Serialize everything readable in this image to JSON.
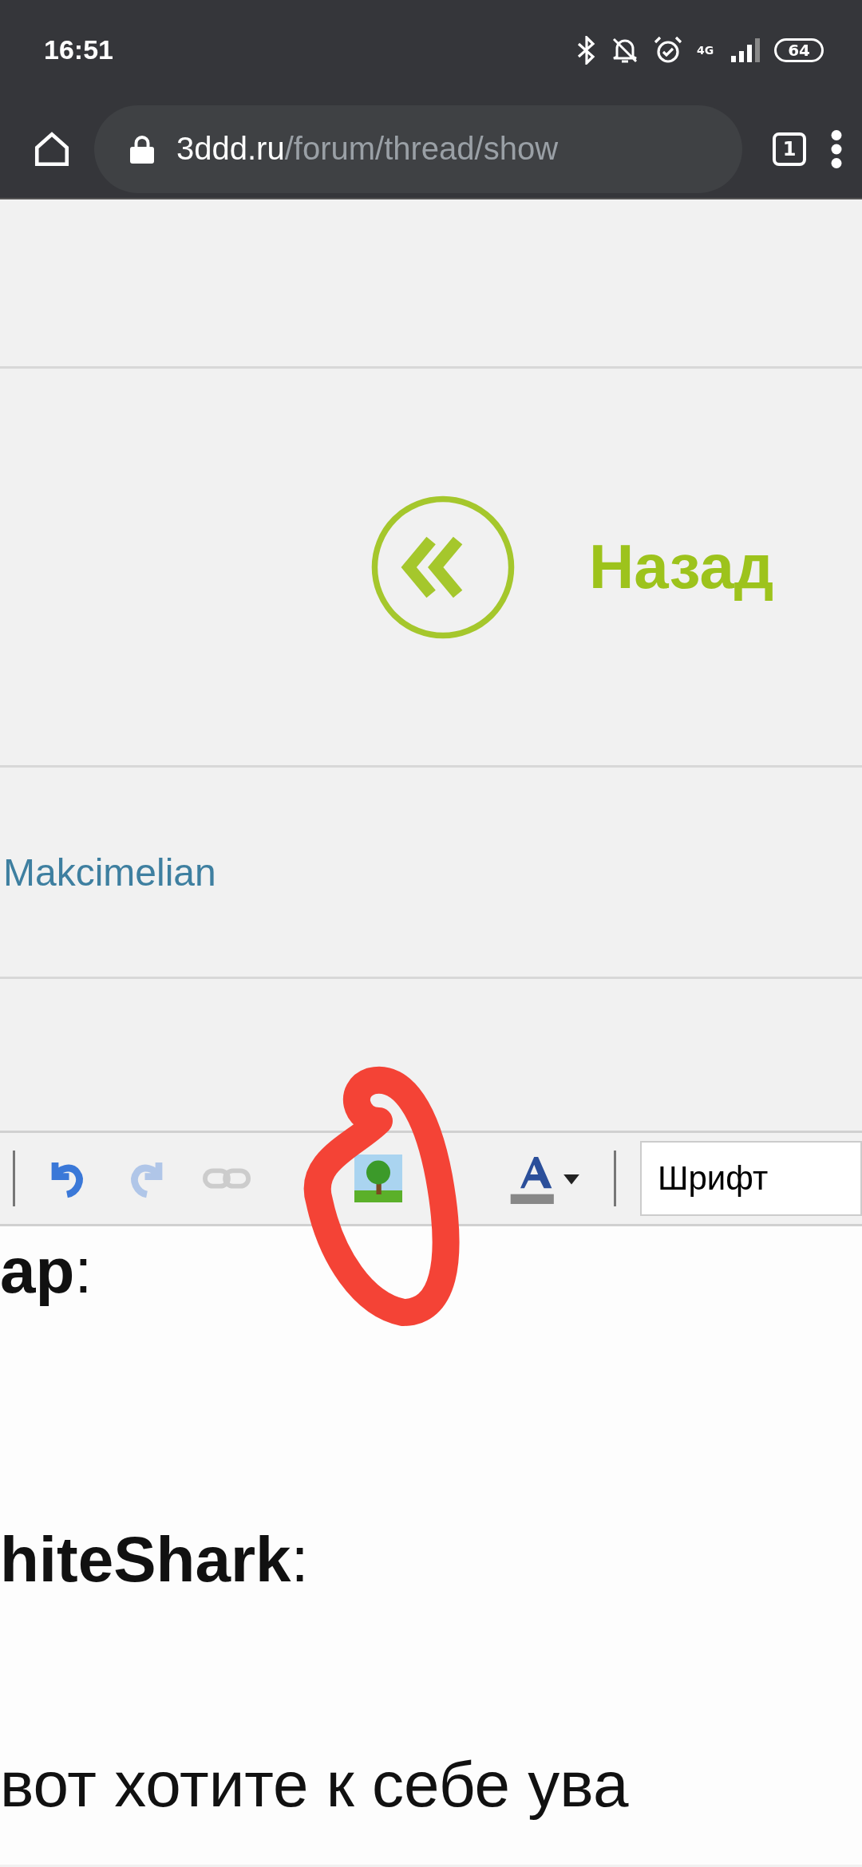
{
  "status_bar": {
    "time": "16:51",
    "network": "4G",
    "battery": "64"
  },
  "browser": {
    "url_host": "3ddd.ru",
    "url_path": "/forum/thread/show",
    "tab_count": "1"
  },
  "back_link": {
    "label": "Назад"
  },
  "author": {
    "name": "Makcimelian"
  },
  "toolbar": {
    "items": [
      {
        "kind": "undo",
        "disabled": false
      },
      {
        "kind": "redo",
        "disabled": true
      },
      {
        "kind": "link",
        "disabled": true
      },
      {
        "kind": "image",
        "disabled": false
      },
      {
        "kind": "color",
        "disabled": false
      }
    ],
    "font_select": {
      "value": "Шрифт"
    }
  },
  "editor": {
    "lines": [
      "**ар**:",
      "**hiteShark**:",
      "вот хотите к себе ува"
    ]
  }
}
